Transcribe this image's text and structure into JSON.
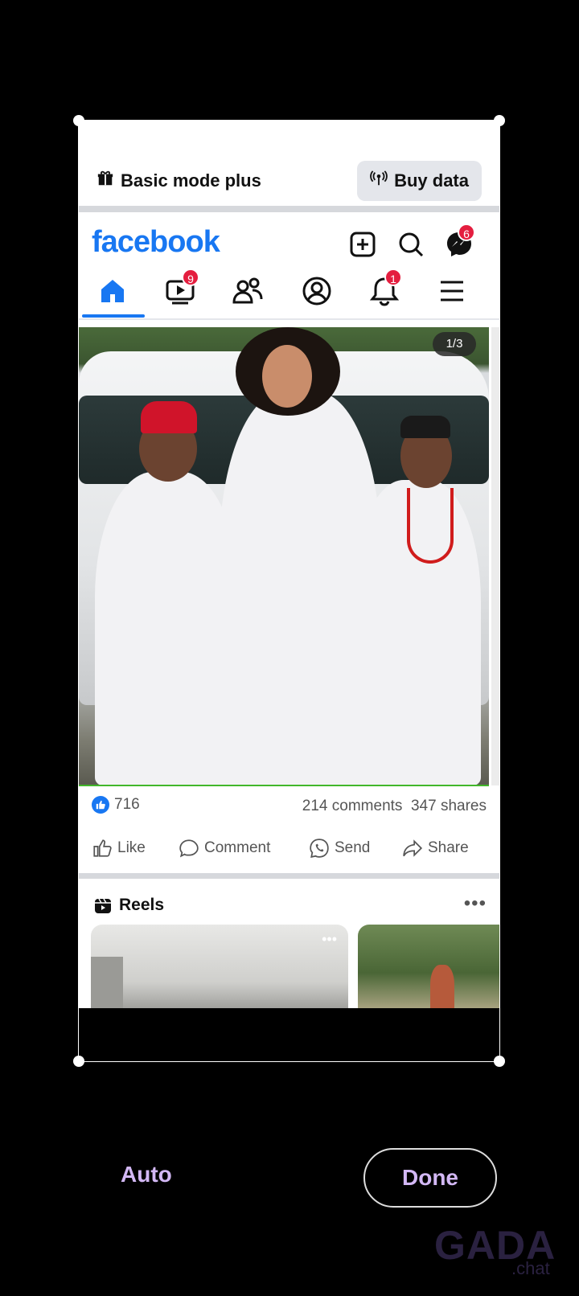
{
  "banner": {
    "basic_mode": "Basic mode plus",
    "buy_data": "Buy data"
  },
  "header": {
    "logo": "facebook",
    "messenger_badge": "6"
  },
  "nav": {
    "video_badge": "9",
    "notifications_badge": "1"
  },
  "post": {
    "image_counter": "1/3",
    "reactions_count": "716",
    "comments": "214 comments",
    "shares": "347 shares",
    "actions": {
      "like": "Like",
      "comment": "Comment",
      "send": "Send",
      "share": "Share"
    }
  },
  "reels": {
    "title": "Reels",
    "more": "•••"
  },
  "editor": {
    "auto_label": "Auto",
    "done_label": "Done"
  },
  "watermark": {
    "main": "GADA",
    "sub": ".chat"
  },
  "colors": {
    "brand": "#1877f2",
    "badge": "#e41e3f",
    "accent": "#d3b8f5"
  }
}
